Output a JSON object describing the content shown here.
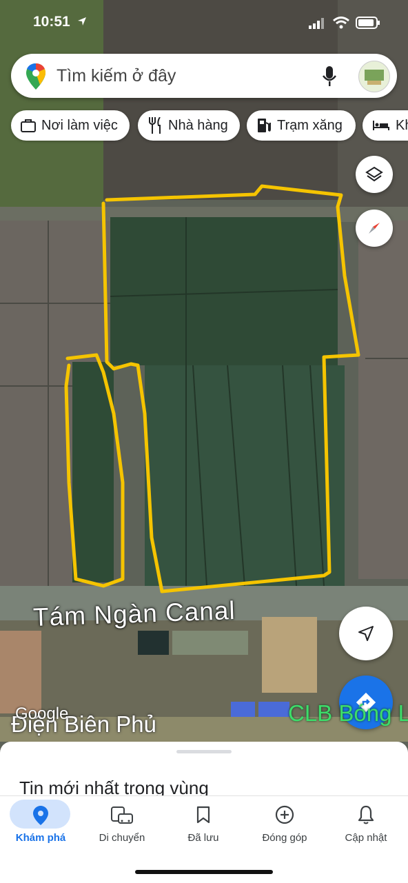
{
  "status_bar": {
    "time": "10:51"
  },
  "search": {
    "placeholder": "Tìm kiếm ở đây"
  },
  "chips": [
    {
      "label": "Nơi làm việc",
      "icon": "briefcase-icon"
    },
    {
      "label": "Nhà hàng",
      "icon": "restaurant-icon"
    },
    {
      "label": "Trạm xăng",
      "icon": "gas-station-icon"
    },
    {
      "label": "Kh",
      "icon": "hotel-icon"
    }
  ],
  "map": {
    "canal_label": "Tám Ngàn Canal",
    "road_label": "Điện Biên Phủ",
    "attribution": "Google",
    "poi_label": "CLB Bóng L"
  },
  "sheet": {
    "title": "Tin mới nhất trong vùng"
  },
  "nav": [
    {
      "label": "Khám phá",
      "icon": "explore-pin-icon",
      "active": true
    },
    {
      "label": "Di chuyển",
      "icon": "commute-icon",
      "active": false
    },
    {
      "label": "Đã lưu",
      "icon": "bookmark-icon",
      "active": false
    },
    {
      "label": "Đóng góp",
      "icon": "add-circle-icon",
      "active": false
    },
    {
      "label": "Cập nhật",
      "icon": "bell-icon",
      "active": false
    }
  ],
  "colors": {
    "accent": "#1a73e8",
    "outline": "#f5c400",
    "active_pill": "#d2e3fc"
  }
}
